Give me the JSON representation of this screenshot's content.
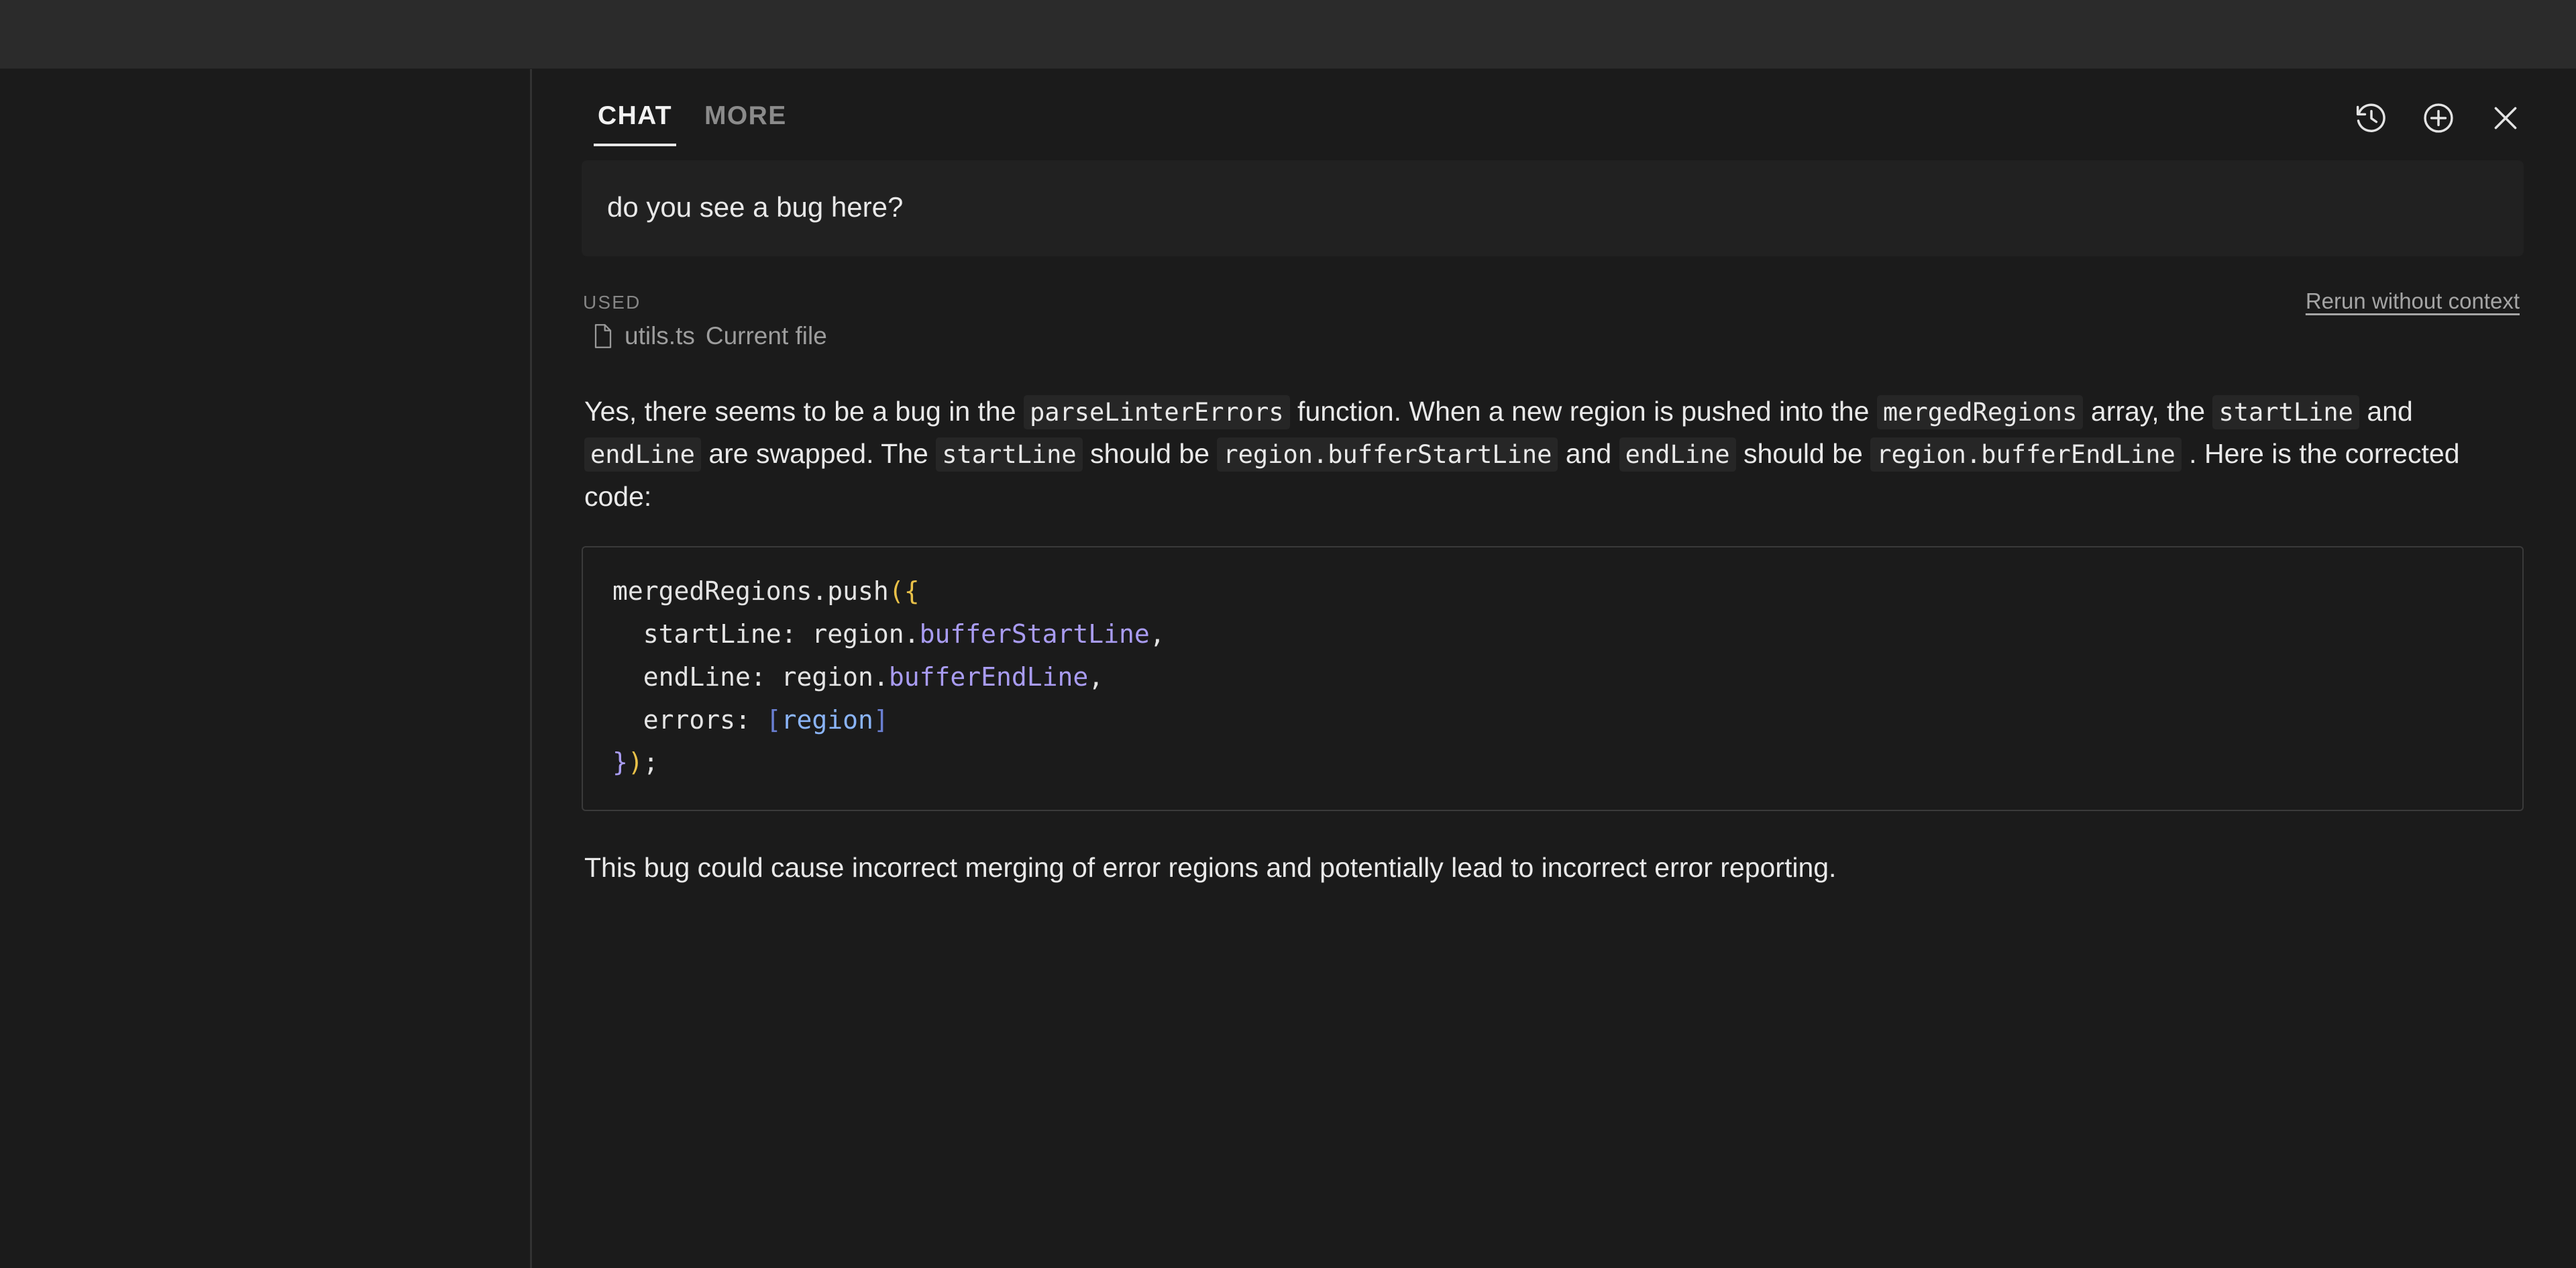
{
  "window": {
    "background": "#1b1b1b",
    "topbar_background": "#2b2b2b"
  },
  "chat_panel": {
    "tabs": [
      {
        "label": "CHAT",
        "active": true
      },
      {
        "label": "MORE",
        "active": false
      }
    ],
    "actions": [
      {
        "name": "history-icon",
        "title": "History"
      },
      {
        "name": "plus-circle-icon",
        "title": "New chat"
      },
      {
        "name": "close-icon",
        "title": "Close"
      }
    ],
    "user_message": "do you see a bug here?",
    "context": {
      "used_label": "USED",
      "rerun_label": "Rerun without context",
      "file_name": "utils.ts",
      "file_scope": "Current file"
    },
    "answer": {
      "p1_a": "Yes, there seems to be a bug in the",
      "c1": "parseLinterErrors",
      "p1_b": "function. When a new region is pushed into the",
      "c2": "mergedRegions",
      "p1_c": "array, the",
      "c3": "startLine",
      "p1_d": "and",
      "c4": "endLine",
      "p1_e": "are swapped. The",
      "c5": "startLine",
      "p1_f": "should be",
      "c6": "region.bufferStartLine",
      "p1_g": "and",
      "c7": "endLine",
      "p1_h": "should be",
      "c8": "region.bufferEndLine",
      "p1_i": ". Here is the corrected code:"
    },
    "code_block": {
      "language": "typescript",
      "lines": [
        [
          {
            "t": "mergedRegions.push",
            "c": "plain"
          },
          {
            "t": "({",
            "c": "punc-yellow"
          }
        ],
        [
          {
            "t": "  startLine: region.",
            "c": "plain"
          },
          {
            "t": "bufferStartLine",
            "c": "prop"
          },
          {
            "t": ",",
            "c": "plain"
          }
        ],
        [
          {
            "t": "  endLine: region.",
            "c": "plain"
          },
          {
            "t": "bufferEndLine",
            "c": "prop"
          },
          {
            "t": ",",
            "c": "plain"
          }
        ],
        [
          {
            "t": "  errors: ",
            "c": "plain"
          },
          {
            "t": "[",
            "c": "bracket"
          },
          {
            "t": "region",
            "c": "ident-blue"
          },
          {
            "t": "]",
            "c": "bracket"
          }
        ],
        [
          {
            "t": "}",
            "c": "punc-purple"
          },
          {
            "t": ")",
            "c": "punc-yellow"
          },
          {
            "t": ";",
            "c": "plain"
          }
        ]
      ]
    },
    "closing_note": "This bug could cause incorrect merging of error regions and potentially lead to incorrect error reporting."
  }
}
